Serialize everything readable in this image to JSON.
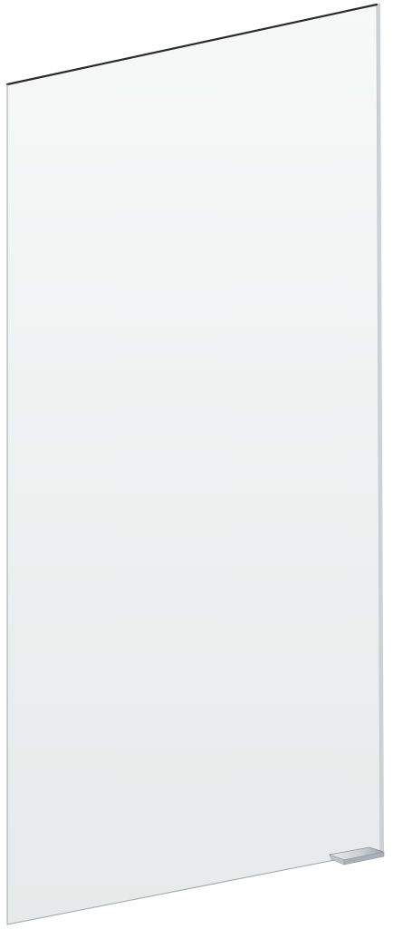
{
  "product": {
    "name": "",
    "colors": {
      "background": "#ffffff",
      "panel_face_top": "#f7f8f8",
      "panel_face_bottom": "#e7e9ea",
      "panel_edge_dark": "#2b2b2b",
      "panel_edge_light": "#b9bcbe",
      "panel_right_edge": "#cfd2d4",
      "handle_light": "#e9ecef",
      "handle_mid": "#c9ced3",
      "handle_dark": "#9aa1a8"
    },
    "icons": [
      "mirror-cabinet-door",
      "handle-clip"
    ]
  }
}
